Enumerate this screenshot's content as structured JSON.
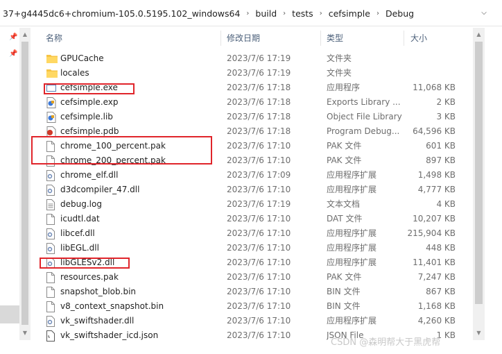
{
  "breadcrumb": [
    "37+g4445dc6+chromium-105.0.5195.102_windows64",
    "build",
    "tests",
    "cefsimple",
    "Debug"
  ],
  "columns": {
    "name": "名称",
    "date": "修改日期",
    "type": "类型",
    "size": "大小"
  },
  "files": [
    {
      "name": "GPUCache",
      "date": "2023/7/6 17:19",
      "type": "文件夹",
      "size": "",
      "icon": "folder-icon"
    },
    {
      "name": "locales",
      "date": "2023/7/6 17:19",
      "type": "文件夹",
      "size": "",
      "icon": "folder-icon"
    },
    {
      "name": "cefsimple.exe",
      "date": "2023/7/6 17:18",
      "type": "应用程序",
      "size": "11,068 KB",
      "icon": "exe-icon"
    },
    {
      "name": "cefsimple.exp",
      "date": "2023/7/6 17:18",
      "type": "Exports Library ...",
      "size": "2 KB",
      "icon": "exp-icon"
    },
    {
      "name": "cefsimple.lib",
      "date": "2023/7/6 17:18",
      "type": "Object File Library",
      "size": "3 KB",
      "icon": "lib-icon"
    },
    {
      "name": "cefsimple.pdb",
      "date": "2023/7/6 17:18",
      "type": "Program Debug...",
      "size": "64,596 KB",
      "icon": "pdb-icon"
    },
    {
      "name": "chrome_100_percent.pak",
      "date": "2023/7/6 17:10",
      "type": "PAK 文件",
      "size": "601 KB",
      "icon": "file-icon"
    },
    {
      "name": "chrome_200_percent.pak",
      "date": "2023/7/6 17:10",
      "type": "PAK 文件",
      "size": "897 KB",
      "icon": "file-icon"
    },
    {
      "name": "chrome_elf.dll",
      "date": "2023/7/6 17:09",
      "type": "应用程序扩展",
      "size": "1,498 KB",
      "icon": "dll-icon"
    },
    {
      "name": "d3dcompiler_47.dll",
      "date": "2023/7/6 17:10",
      "type": "应用程序扩展",
      "size": "4,777 KB",
      "icon": "dll-icon"
    },
    {
      "name": "debug.log",
      "date": "2023/7/6 17:19",
      "type": "文本文档",
      "size": "4 KB",
      "icon": "text-file-icon"
    },
    {
      "name": "icudtl.dat",
      "date": "2023/7/6 17:10",
      "type": "DAT 文件",
      "size": "10,207 KB",
      "icon": "file-icon"
    },
    {
      "name": "libcef.dll",
      "date": "2023/7/6 17:10",
      "type": "应用程序扩展",
      "size": "215,904 KB",
      "icon": "dll-icon"
    },
    {
      "name": "libEGL.dll",
      "date": "2023/7/6 17:10",
      "type": "应用程序扩展",
      "size": "448 KB",
      "icon": "dll-icon"
    },
    {
      "name": "libGLESv2.dll",
      "date": "2023/7/6 17:10",
      "type": "应用程序扩展",
      "size": "11,401 KB",
      "icon": "dll-icon"
    },
    {
      "name": "resources.pak",
      "date": "2023/7/6 17:10",
      "type": "PAK 文件",
      "size": "7,247 KB",
      "icon": "file-icon"
    },
    {
      "name": "snapshot_blob.bin",
      "date": "2023/7/6 17:10",
      "type": "BIN 文件",
      "size": "867 KB",
      "icon": "file-icon"
    },
    {
      "name": "v8_context_snapshot.bin",
      "date": "2023/7/6 17:10",
      "type": "BIN 文件",
      "size": "1,168 KB",
      "icon": "file-icon"
    },
    {
      "name": "vk_swiftshader.dll",
      "date": "2023/7/6 17:10",
      "type": "应用程序扩展",
      "size": "4,260 KB",
      "icon": "dll-icon"
    },
    {
      "name": "vk_swiftshader_icd.json",
      "date": "2023/7/6 17:10",
      "type": "JSON File",
      "size": "1 KB",
      "icon": "json-file-icon"
    }
  ],
  "highlight_color": "#e0242a",
  "watermark": "CSDN @森明帮大于黑虎帮"
}
